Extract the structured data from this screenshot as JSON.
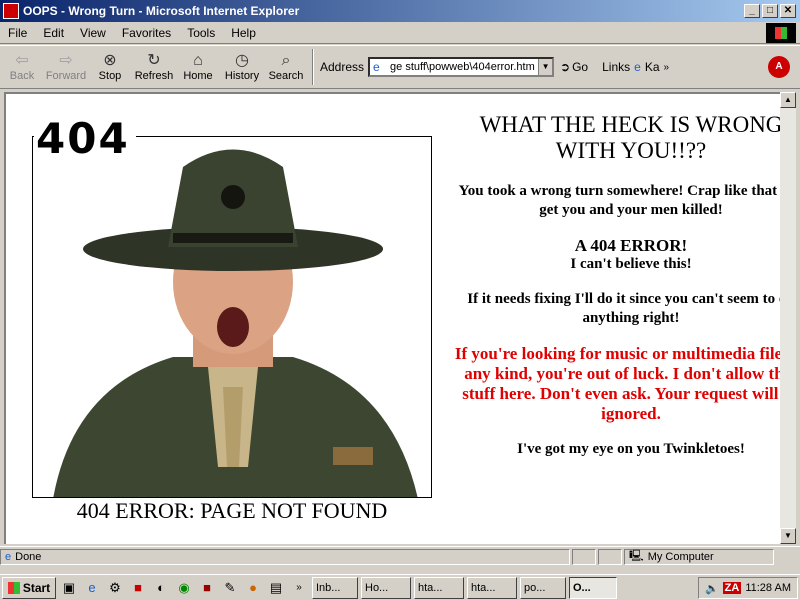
{
  "window": {
    "title": "OOPS - Wrong Turn - Microsoft Internet Explorer",
    "minimize": "_",
    "maximize": "□",
    "close": "✕"
  },
  "menu": [
    "File",
    "Edit",
    "View",
    "Favorites",
    "Tools",
    "Help"
  ],
  "toolbar": {
    "back": "Back",
    "forward": "Forward",
    "stop": "Stop",
    "refresh": "Refresh",
    "home": "Home",
    "history": "History",
    "search": "Search",
    "address_label": "Address",
    "address_value": "ge stuff\\powweb\\404error.htm",
    "go": "Go",
    "links": "Links",
    "links_item": "Ka"
  },
  "page": {
    "big_404": "404",
    "caption": "404 ERROR: PAGE NOT FOUND",
    "heading": "WHAT THE HECK IS WRONG WITH YOU!!??",
    "para1": "You took a wrong turn somewhere! Crap like that can get you and your men killed!",
    "error_title": "A 404 ERROR!",
    "error_sub": "I can't believe this!",
    "para3": "If it needs fixing I'll do it since you can't seem to do anything right!",
    "red_text": "If you're looking for music or multimedia files of any kind, you're out of luck. I don't allow that stuff here. Don't even ask. Your request will be ignored.",
    "closing": "I've got my eye on you Twinkletoes!"
  },
  "status": {
    "text": "Done",
    "zone": "My Computer"
  },
  "taskbar": {
    "start": "Start",
    "tasks": [
      "Inb...",
      "Ho...",
      "hta...",
      "hta...",
      "po...",
      "O..."
    ],
    "clock": "11:28 AM"
  },
  "colors": {
    "title_bar": "#0a246a",
    "red_text": "#e00000"
  }
}
